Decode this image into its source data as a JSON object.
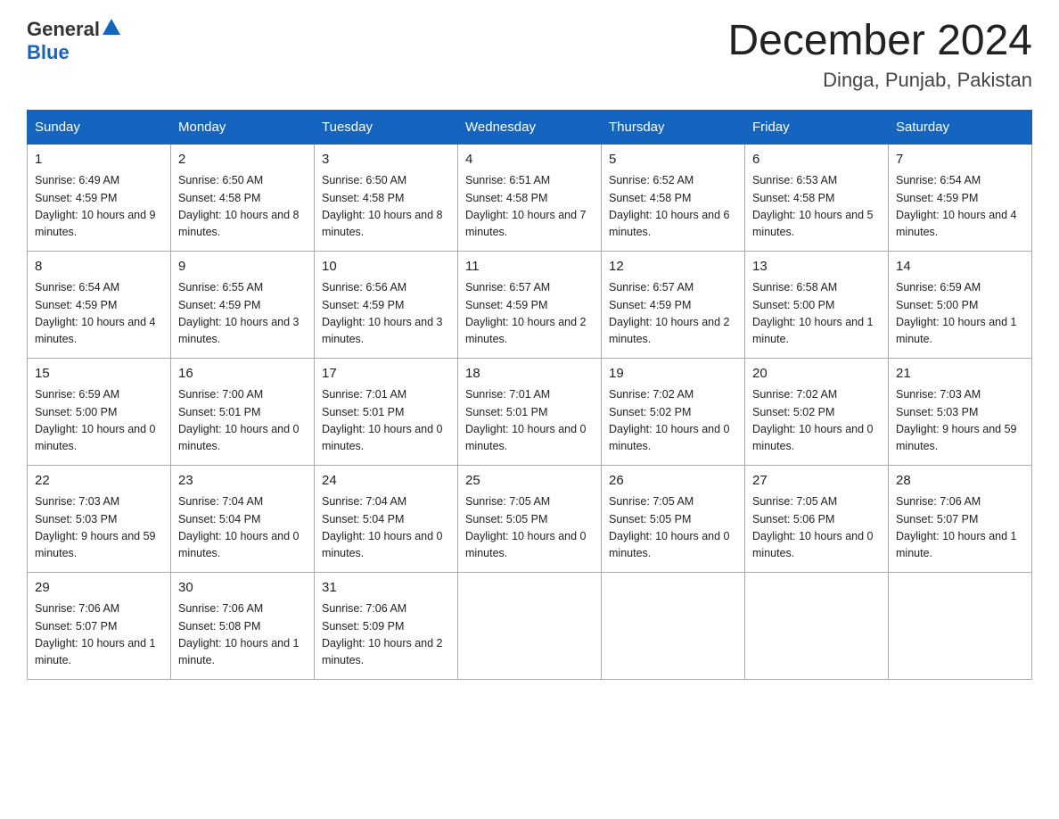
{
  "header": {
    "logo_general": "General",
    "logo_blue": "Blue",
    "title": "December 2024",
    "subtitle": "Dinga, Punjab, Pakistan"
  },
  "calendar": {
    "days_of_week": [
      "Sunday",
      "Monday",
      "Tuesday",
      "Wednesday",
      "Thursday",
      "Friday",
      "Saturday"
    ],
    "weeks": [
      [
        {
          "day": "1",
          "sunrise": "6:49 AM",
          "sunset": "4:59 PM",
          "daylight": "10 hours and 9 minutes."
        },
        {
          "day": "2",
          "sunrise": "6:50 AM",
          "sunset": "4:58 PM",
          "daylight": "10 hours and 8 minutes."
        },
        {
          "day": "3",
          "sunrise": "6:50 AM",
          "sunset": "4:58 PM",
          "daylight": "10 hours and 8 minutes."
        },
        {
          "day": "4",
          "sunrise": "6:51 AM",
          "sunset": "4:58 PM",
          "daylight": "10 hours and 7 minutes."
        },
        {
          "day": "5",
          "sunrise": "6:52 AM",
          "sunset": "4:58 PM",
          "daylight": "10 hours and 6 minutes."
        },
        {
          "day": "6",
          "sunrise": "6:53 AM",
          "sunset": "4:58 PM",
          "daylight": "10 hours and 5 minutes."
        },
        {
          "day": "7",
          "sunrise": "6:54 AM",
          "sunset": "4:59 PM",
          "daylight": "10 hours and 4 minutes."
        }
      ],
      [
        {
          "day": "8",
          "sunrise": "6:54 AM",
          "sunset": "4:59 PM",
          "daylight": "10 hours and 4 minutes."
        },
        {
          "day": "9",
          "sunrise": "6:55 AM",
          "sunset": "4:59 PM",
          "daylight": "10 hours and 3 minutes."
        },
        {
          "day": "10",
          "sunrise": "6:56 AM",
          "sunset": "4:59 PM",
          "daylight": "10 hours and 3 minutes."
        },
        {
          "day": "11",
          "sunrise": "6:57 AM",
          "sunset": "4:59 PM",
          "daylight": "10 hours and 2 minutes."
        },
        {
          "day": "12",
          "sunrise": "6:57 AM",
          "sunset": "4:59 PM",
          "daylight": "10 hours and 2 minutes."
        },
        {
          "day": "13",
          "sunrise": "6:58 AM",
          "sunset": "5:00 PM",
          "daylight": "10 hours and 1 minute."
        },
        {
          "day": "14",
          "sunrise": "6:59 AM",
          "sunset": "5:00 PM",
          "daylight": "10 hours and 1 minute."
        }
      ],
      [
        {
          "day": "15",
          "sunrise": "6:59 AM",
          "sunset": "5:00 PM",
          "daylight": "10 hours and 0 minutes."
        },
        {
          "day": "16",
          "sunrise": "7:00 AM",
          "sunset": "5:01 PM",
          "daylight": "10 hours and 0 minutes."
        },
        {
          "day": "17",
          "sunrise": "7:01 AM",
          "sunset": "5:01 PM",
          "daylight": "10 hours and 0 minutes."
        },
        {
          "day": "18",
          "sunrise": "7:01 AM",
          "sunset": "5:01 PM",
          "daylight": "10 hours and 0 minutes."
        },
        {
          "day": "19",
          "sunrise": "7:02 AM",
          "sunset": "5:02 PM",
          "daylight": "10 hours and 0 minutes."
        },
        {
          "day": "20",
          "sunrise": "7:02 AM",
          "sunset": "5:02 PM",
          "daylight": "10 hours and 0 minutes."
        },
        {
          "day": "21",
          "sunrise": "7:03 AM",
          "sunset": "5:03 PM",
          "daylight": "9 hours and 59 minutes."
        }
      ],
      [
        {
          "day": "22",
          "sunrise": "7:03 AM",
          "sunset": "5:03 PM",
          "daylight": "9 hours and 59 minutes."
        },
        {
          "day": "23",
          "sunrise": "7:04 AM",
          "sunset": "5:04 PM",
          "daylight": "10 hours and 0 minutes."
        },
        {
          "day": "24",
          "sunrise": "7:04 AM",
          "sunset": "5:04 PM",
          "daylight": "10 hours and 0 minutes."
        },
        {
          "day": "25",
          "sunrise": "7:05 AM",
          "sunset": "5:05 PM",
          "daylight": "10 hours and 0 minutes."
        },
        {
          "day": "26",
          "sunrise": "7:05 AM",
          "sunset": "5:05 PM",
          "daylight": "10 hours and 0 minutes."
        },
        {
          "day": "27",
          "sunrise": "7:05 AM",
          "sunset": "5:06 PM",
          "daylight": "10 hours and 0 minutes."
        },
        {
          "day": "28",
          "sunrise": "7:06 AM",
          "sunset": "5:07 PM",
          "daylight": "10 hours and 1 minute."
        }
      ],
      [
        {
          "day": "29",
          "sunrise": "7:06 AM",
          "sunset": "5:07 PM",
          "daylight": "10 hours and 1 minute."
        },
        {
          "day": "30",
          "sunrise": "7:06 AM",
          "sunset": "5:08 PM",
          "daylight": "10 hours and 1 minute."
        },
        {
          "day": "31",
          "sunrise": "7:06 AM",
          "sunset": "5:09 PM",
          "daylight": "10 hours and 2 minutes."
        },
        null,
        null,
        null,
        null
      ]
    ]
  }
}
